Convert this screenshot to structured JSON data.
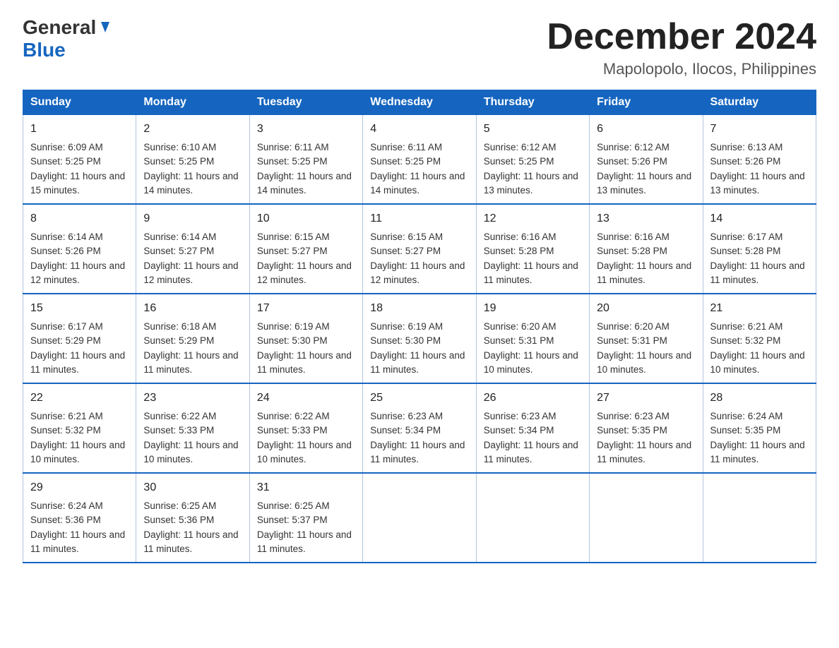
{
  "header": {
    "logo_general": "General",
    "logo_blue": "Blue",
    "title": "December 2024",
    "subtitle": "Mapolopolo, Ilocos, Philippines"
  },
  "days": [
    "Sunday",
    "Monday",
    "Tuesday",
    "Wednesday",
    "Thursday",
    "Friday",
    "Saturday"
  ],
  "weeks": [
    [
      {
        "day": "1",
        "sunrise": "6:09 AM",
        "sunset": "5:25 PM",
        "daylight": "11 hours and 15 minutes."
      },
      {
        "day": "2",
        "sunrise": "6:10 AM",
        "sunset": "5:25 PM",
        "daylight": "11 hours and 14 minutes."
      },
      {
        "day": "3",
        "sunrise": "6:11 AM",
        "sunset": "5:25 PM",
        "daylight": "11 hours and 14 minutes."
      },
      {
        "day": "4",
        "sunrise": "6:11 AM",
        "sunset": "5:25 PM",
        "daylight": "11 hours and 14 minutes."
      },
      {
        "day": "5",
        "sunrise": "6:12 AM",
        "sunset": "5:25 PM",
        "daylight": "11 hours and 13 minutes."
      },
      {
        "day": "6",
        "sunrise": "6:12 AM",
        "sunset": "5:26 PM",
        "daylight": "11 hours and 13 minutes."
      },
      {
        "day": "7",
        "sunrise": "6:13 AM",
        "sunset": "5:26 PM",
        "daylight": "11 hours and 13 minutes."
      }
    ],
    [
      {
        "day": "8",
        "sunrise": "6:14 AM",
        "sunset": "5:26 PM",
        "daylight": "11 hours and 12 minutes."
      },
      {
        "day": "9",
        "sunrise": "6:14 AM",
        "sunset": "5:27 PM",
        "daylight": "11 hours and 12 minutes."
      },
      {
        "day": "10",
        "sunrise": "6:15 AM",
        "sunset": "5:27 PM",
        "daylight": "11 hours and 12 minutes."
      },
      {
        "day": "11",
        "sunrise": "6:15 AM",
        "sunset": "5:27 PM",
        "daylight": "11 hours and 12 minutes."
      },
      {
        "day": "12",
        "sunrise": "6:16 AM",
        "sunset": "5:28 PM",
        "daylight": "11 hours and 11 minutes."
      },
      {
        "day": "13",
        "sunrise": "6:16 AM",
        "sunset": "5:28 PM",
        "daylight": "11 hours and 11 minutes."
      },
      {
        "day": "14",
        "sunrise": "6:17 AM",
        "sunset": "5:28 PM",
        "daylight": "11 hours and 11 minutes."
      }
    ],
    [
      {
        "day": "15",
        "sunrise": "6:17 AM",
        "sunset": "5:29 PM",
        "daylight": "11 hours and 11 minutes."
      },
      {
        "day": "16",
        "sunrise": "6:18 AM",
        "sunset": "5:29 PM",
        "daylight": "11 hours and 11 minutes."
      },
      {
        "day": "17",
        "sunrise": "6:19 AM",
        "sunset": "5:30 PM",
        "daylight": "11 hours and 11 minutes."
      },
      {
        "day": "18",
        "sunrise": "6:19 AM",
        "sunset": "5:30 PM",
        "daylight": "11 hours and 11 minutes."
      },
      {
        "day": "19",
        "sunrise": "6:20 AM",
        "sunset": "5:31 PM",
        "daylight": "11 hours and 10 minutes."
      },
      {
        "day": "20",
        "sunrise": "6:20 AM",
        "sunset": "5:31 PM",
        "daylight": "11 hours and 10 minutes."
      },
      {
        "day": "21",
        "sunrise": "6:21 AM",
        "sunset": "5:32 PM",
        "daylight": "11 hours and 10 minutes."
      }
    ],
    [
      {
        "day": "22",
        "sunrise": "6:21 AM",
        "sunset": "5:32 PM",
        "daylight": "11 hours and 10 minutes."
      },
      {
        "day": "23",
        "sunrise": "6:22 AM",
        "sunset": "5:33 PM",
        "daylight": "11 hours and 10 minutes."
      },
      {
        "day": "24",
        "sunrise": "6:22 AM",
        "sunset": "5:33 PM",
        "daylight": "11 hours and 10 minutes."
      },
      {
        "day": "25",
        "sunrise": "6:23 AM",
        "sunset": "5:34 PM",
        "daylight": "11 hours and 11 minutes."
      },
      {
        "day": "26",
        "sunrise": "6:23 AM",
        "sunset": "5:34 PM",
        "daylight": "11 hours and 11 minutes."
      },
      {
        "day": "27",
        "sunrise": "6:23 AM",
        "sunset": "5:35 PM",
        "daylight": "11 hours and 11 minutes."
      },
      {
        "day": "28",
        "sunrise": "6:24 AM",
        "sunset": "5:35 PM",
        "daylight": "11 hours and 11 minutes."
      }
    ],
    [
      {
        "day": "29",
        "sunrise": "6:24 AM",
        "sunset": "5:36 PM",
        "daylight": "11 hours and 11 minutes."
      },
      {
        "day": "30",
        "sunrise": "6:25 AM",
        "sunset": "5:36 PM",
        "daylight": "11 hours and 11 minutes."
      },
      {
        "day": "31",
        "sunrise": "6:25 AM",
        "sunset": "5:37 PM",
        "daylight": "11 hours and 11 minutes."
      },
      null,
      null,
      null,
      null
    ]
  ]
}
